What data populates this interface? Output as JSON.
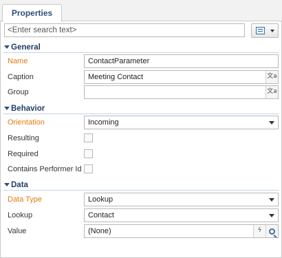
{
  "tabs": [
    {
      "label": "Properties"
    }
  ],
  "search": {
    "placeholder": "<Enter search text>"
  },
  "sections": {
    "general": {
      "title": "General",
      "name_label": "Name",
      "name_value": "ContactParameter",
      "caption_label": "Caption",
      "caption_value": "Meeting Contact",
      "group_label": "Group",
      "group_value": ""
    },
    "behavior": {
      "title": "Behavior",
      "orientation_label": "Orientation",
      "orientation_value": "Incoming",
      "resulting_label": "Resulting",
      "required_label": "Required",
      "contains_performer_label": "Contains Performer Id"
    },
    "data": {
      "title": "Data",
      "data_type_label": "Data Type",
      "data_type_value": "Lookup",
      "lookup_label": "Lookup",
      "lookup_value": "Contact",
      "value_label": "Value",
      "value_value": "(None)"
    }
  },
  "icons": {
    "localize": "localize-icon",
    "search": "search-icon",
    "formula": "lightning-icon",
    "view_menu": "list-view-icon",
    "dropdown": "chevron-down-icon",
    "collapse": "triangle-down-icon"
  },
  "colors": {
    "required_label": "#e07c10",
    "section_title": "#1f3d66",
    "tab_text": "#2a4f7c"
  }
}
